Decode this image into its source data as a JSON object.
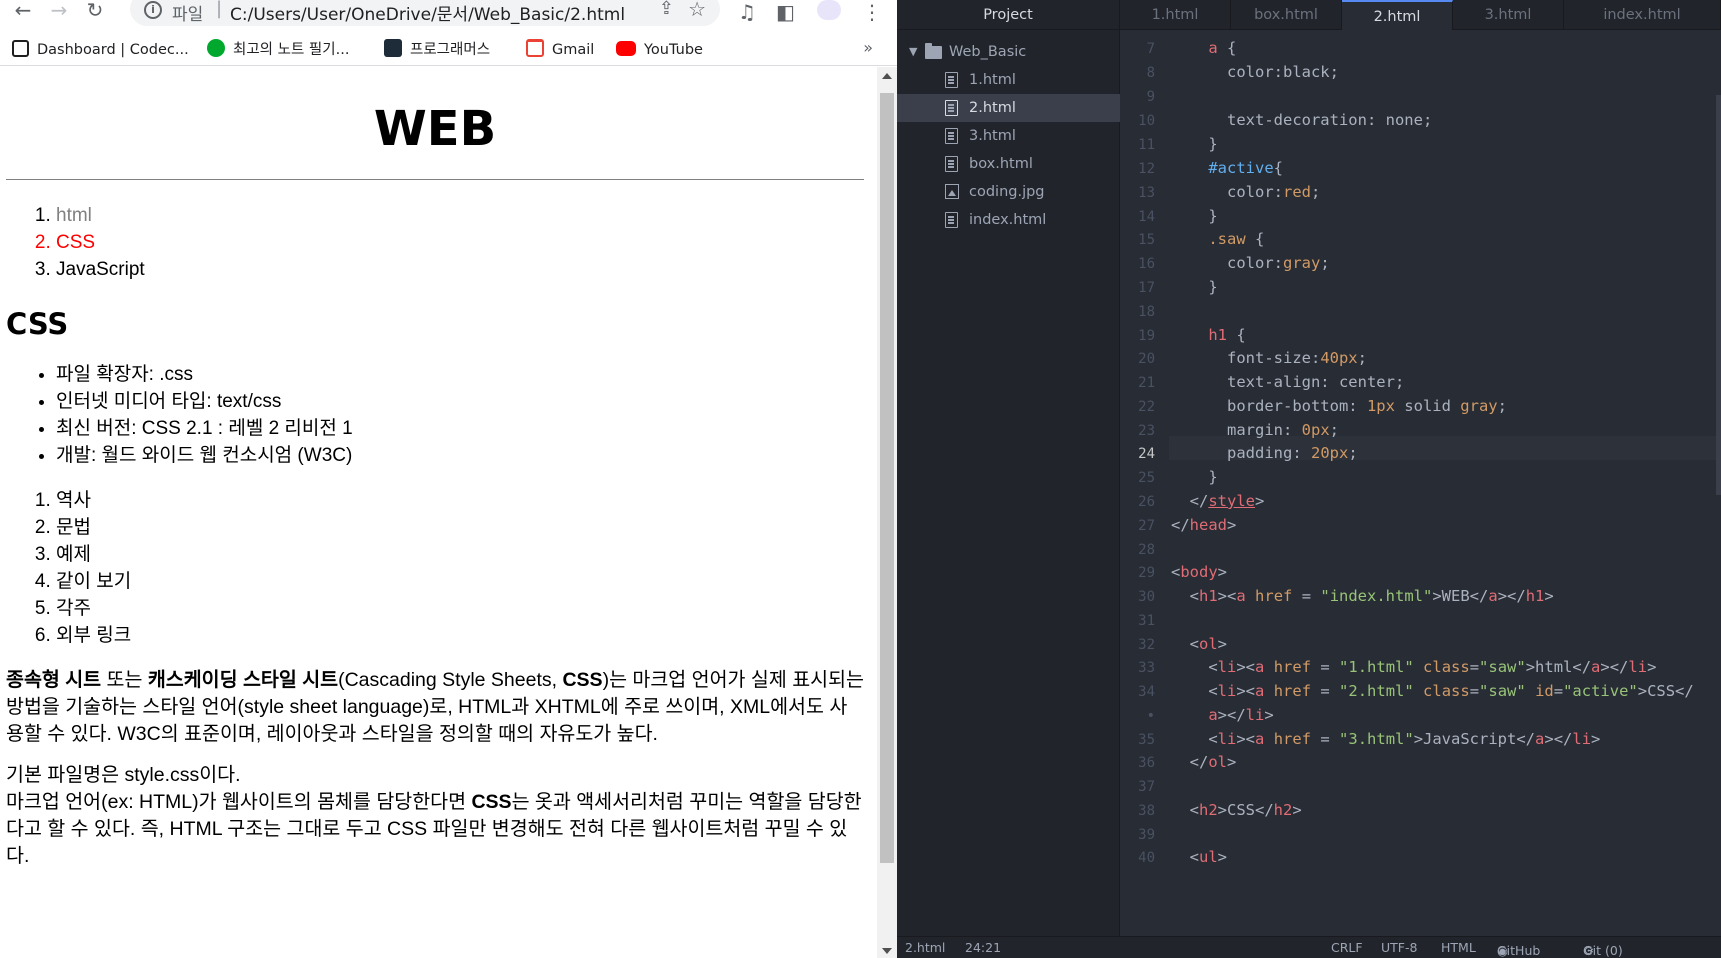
{
  "browser": {
    "nav": {
      "back": "←",
      "forward": "→",
      "reload": "↻"
    },
    "omnibox": {
      "scheme": "파일",
      "url": "C:/Users/User/OneDrive/문서/Web_Basic/2.html"
    },
    "bookmarks": [
      {
        "label": "Dashboard | Codec...",
        "icon": "codecademy-icon",
        "color": "#1f1f1f"
      },
      {
        "label": "최고의 노트 필기...",
        "icon": "evernote-icon",
        "color": "#00a82d"
      },
      {
        "label": "프로그래머스",
        "icon": "programmers-icon",
        "color": "#1e2b39"
      },
      {
        "label": "Gmail",
        "icon": "gmail-icon",
        "color": "#ea4335"
      },
      {
        "label": "YouTube",
        "icon": "youtube-icon",
        "color": "#ff0000"
      }
    ],
    "more": "»"
  },
  "page": {
    "title": "WEB",
    "nav": [
      {
        "label": "html",
        "style": "saw"
      },
      {
        "label": "CSS",
        "style": "active"
      },
      {
        "label": "JavaScript",
        "style": "plain"
      }
    ],
    "heading": "CSS",
    "facts": [
      "파일 확장자: .css",
      "인터넷 미디어 타입: text/css",
      "최신 버전: CSS 2.1 : 레벨 2 리비전 1",
      "개발: 월드 와이드 웹 컨소시엄 (W3C)"
    ],
    "toc": [
      "역사",
      "문법",
      "예제",
      "같이 보기",
      "각주",
      "외부 링크"
    ],
    "p1": {
      "b1": "종속형 시트",
      "t1": " 또는 ",
      "b2": "캐스케이딩 스타일 시트",
      "t2": "(Cascading Style Sheets, ",
      "b3": "CSS",
      "t3": ")는 마크업 언어가 실제 표시되는 방법을 기술하는 스타일 언어(style sheet language)로, HTML과 XHTML에 주로 쓰이며, XML에서도 사용할 수 있다. W3C의 표준이며, 레이아웃과 스타일을 정의할 때의 자유도가 높다."
    },
    "p2": {
      "line1": "기본 파일명은 style.css이다.",
      "t1": "마크업 언어(ex: HTML)가 웹사이트의 몸체를 담당한다면 ",
      "b1": "CSS",
      "t2": "는 옷과 액세서리처럼 꾸미는 역할을 담당한다고 할 수 있다. 즉, HTML 구조는 그대로 두고 CSS 파일만 변경해도 전혀 다른 웹사이트처럼 꾸밀 수 있다."
    }
  },
  "editor": {
    "tree": {
      "header": "Project",
      "folder": "Web_Basic",
      "files": [
        "1.html",
        "2.html",
        "3.html",
        "box.html",
        "coding.jpg",
        "index.html"
      ],
      "selected": "2.html"
    },
    "tabs": [
      "1.html",
      "box.html",
      "2.html",
      "3.html",
      "index.html"
    ],
    "active_tab": "2.html",
    "line_numbers": [
      "7",
      "8",
      "9",
      "10",
      "11",
      "12",
      "13",
      "14",
      "15",
      "16",
      "17",
      "18",
      "19",
      "20",
      "21",
      "22",
      "23",
      "24",
      "25",
      "26",
      "27",
      "28",
      "29",
      "30",
      "31",
      "32",
      "33",
      "34",
      "•",
      "35",
      "36",
      "37",
      "38",
      "39",
      "40"
    ],
    "current_line": "24",
    "status": {
      "file": "2.html",
      "cursor": "24:21",
      "eol": "CRLF",
      "encoding": "UTF-8",
      "grammar": "HTML",
      "github": "GitHub",
      "git": "Git (0)"
    }
  }
}
